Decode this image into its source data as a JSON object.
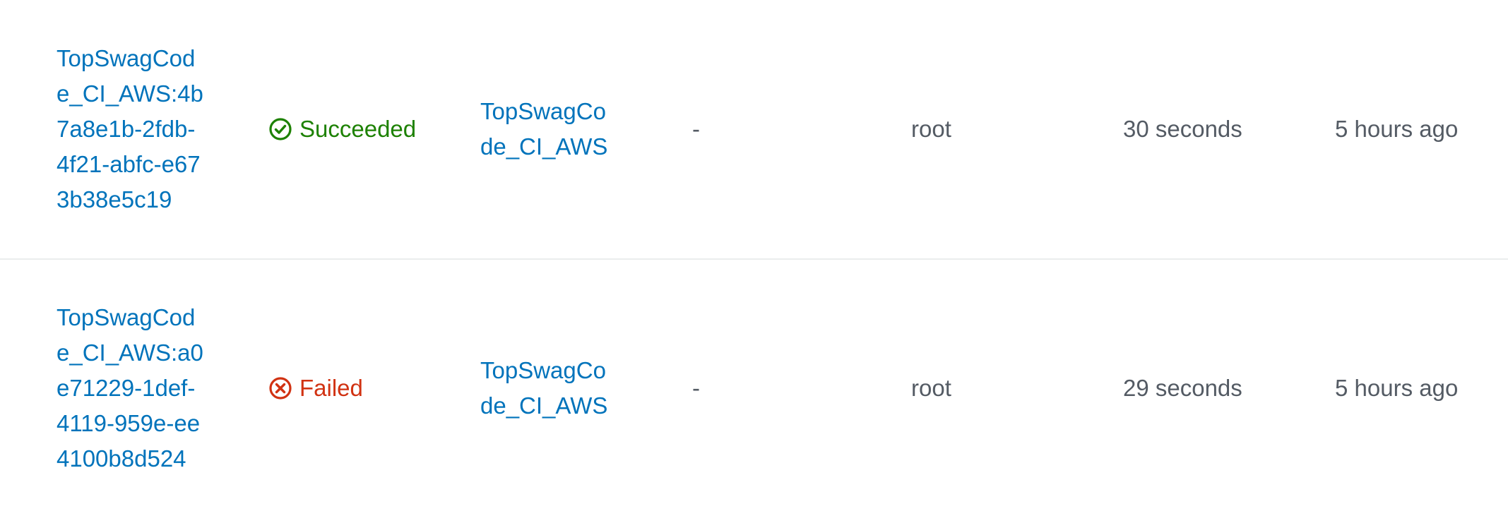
{
  "colors": {
    "link": "#0073bb",
    "success": "#1d8102",
    "failure": "#d13212",
    "text": "#545b64",
    "divider": "#eaeded"
  },
  "rows": [
    {
      "build_run": "TopSwagCode_CI_AWS:4b7a8e1b-2fdb-4f21-abfc-e673b38e5c19",
      "status": "Succeeded",
      "status_icon": "check-circle-icon",
      "project": "TopSwagCode_CI_AWS",
      "source_version": "-",
      "initiator": "root",
      "duration": "30 seconds",
      "completed": "5 hours ago"
    },
    {
      "build_run": "TopSwagCode_CI_AWS:a0e71229-1def-4119-959e-ee4100b8d524",
      "status": "Failed",
      "status_icon": "x-circle-icon",
      "project": "TopSwagCode_CI_AWS",
      "source_version": "-",
      "initiator": "root",
      "duration": "29 seconds",
      "completed": "5 hours ago"
    }
  ]
}
